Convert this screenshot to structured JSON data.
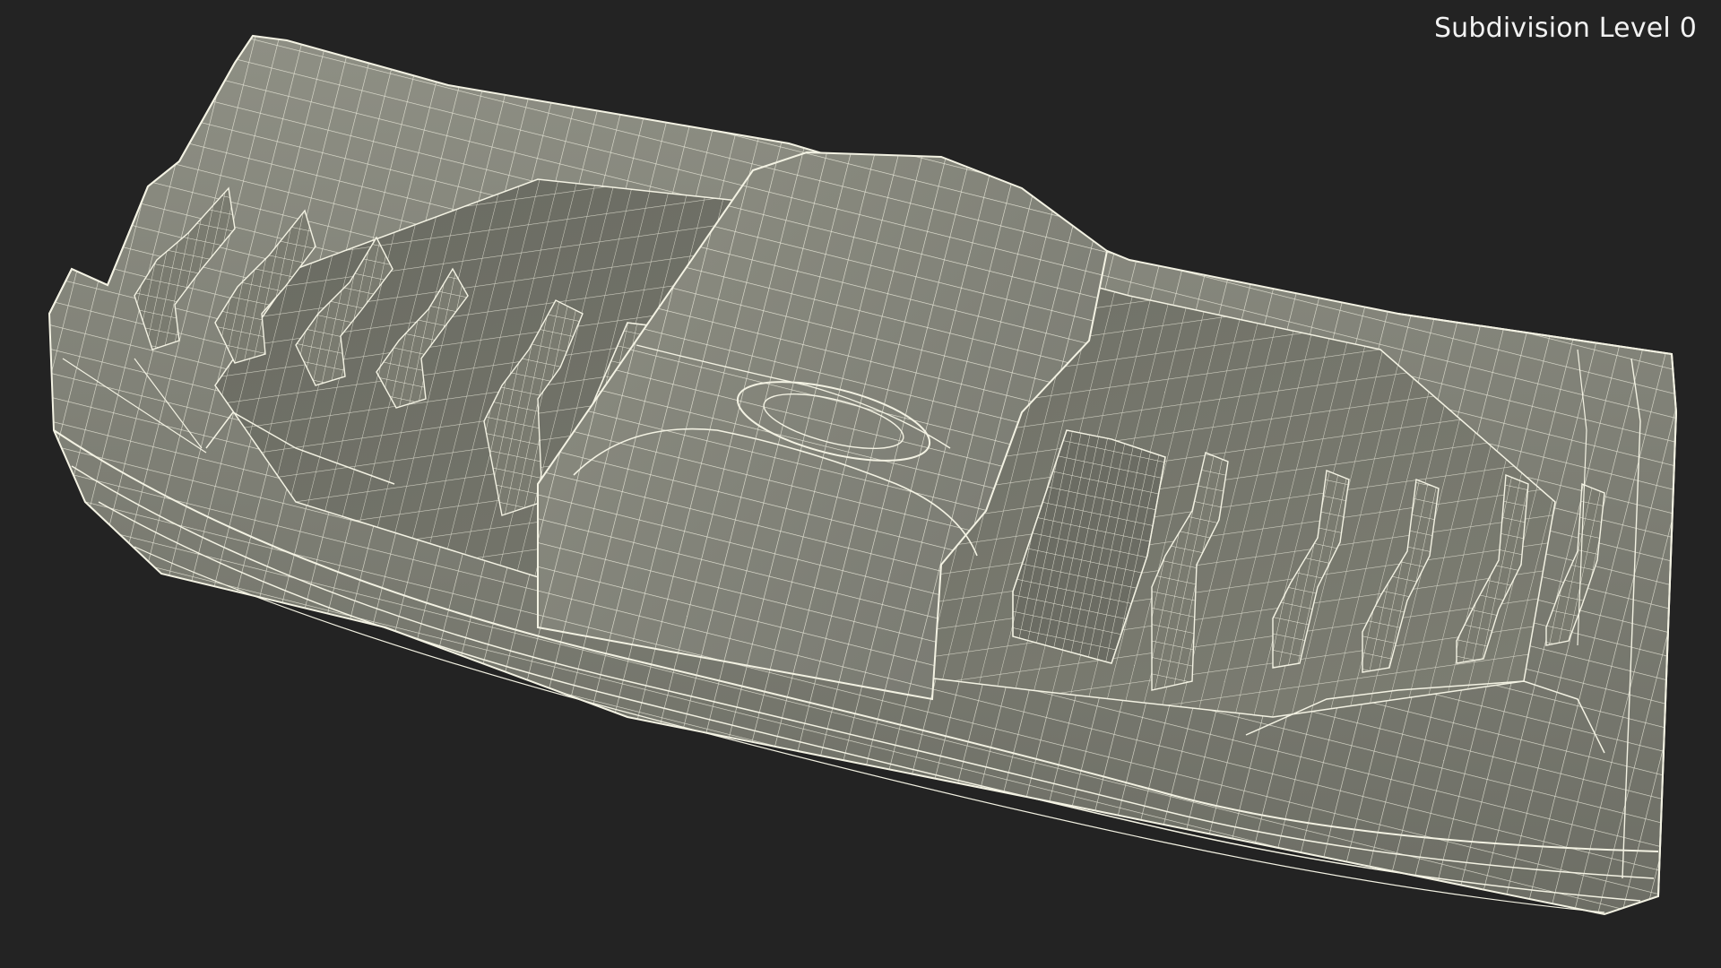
{
  "viewport": {
    "overlay_label": "Subdivision Level 0",
    "background_color": "#232323"
  },
  "model": {
    "surface_color": "#85867a",
    "surface_dark_color": "#5f6057",
    "wire_color": "#f3f2e3"
  }
}
